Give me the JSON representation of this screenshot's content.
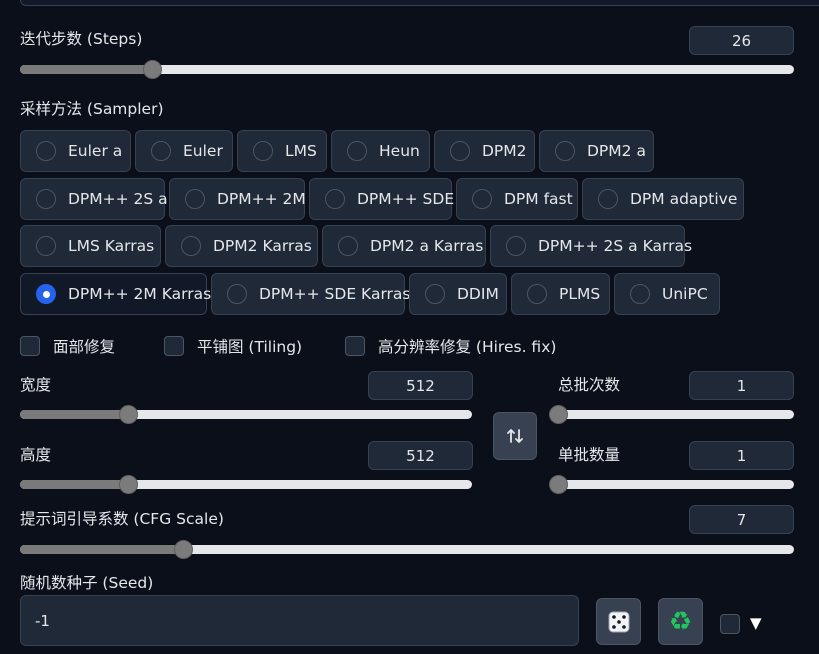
{
  "steps": {
    "label": "迭代步数 (Steps)",
    "value": "26",
    "level": 0.17
  },
  "sampler": {
    "label": "采样方法 (Sampler)",
    "rows": [
      [
        "Euler a",
        "Euler",
        "LMS",
        "Heun",
        "DPM2",
        "DPM2 a"
      ],
      [
        "DPM++ 2S a",
        "DPM++ 2M",
        "DPM++ SDE",
        "DPM fast",
        "DPM adaptive"
      ],
      [
        "LMS Karras",
        "DPM2 Karras",
        "DPM2 a Karras",
        "DPM++ 2S a Karras"
      ],
      [
        "DPM++ 2M Karras",
        "DPM++ SDE Karras",
        "DDIM",
        "PLMS",
        "UniPC"
      ]
    ],
    "selected": "DPM++ 2M Karras"
  },
  "options": {
    "face_restore": "面部修复",
    "tiling": "平铺图 (Tiling)",
    "hires_fix": "高分辨率修复 (Hires. fix)"
  },
  "width": {
    "label": "宽度",
    "value": "512",
    "level": 0.24
  },
  "height": {
    "label": "高度",
    "value": "512",
    "level": 0.24
  },
  "batch_count": {
    "label": "总批次数",
    "value": "1",
    "level": 0.0
  },
  "batch_size": {
    "label": "单批数量",
    "value": "1",
    "level": 0.0
  },
  "swap_icon": "swap-vertical-arrows",
  "cfg": {
    "label": "提示词引导系数 (CFG Scale)",
    "value": "7",
    "level": 0.21
  },
  "seed": {
    "label": "随机数种子 (Seed)",
    "value": "-1",
    "dice_icon": "dice-icon",
    "recycle_icon": "recycle-icon",
    "toggle": "▼"
  }
}
